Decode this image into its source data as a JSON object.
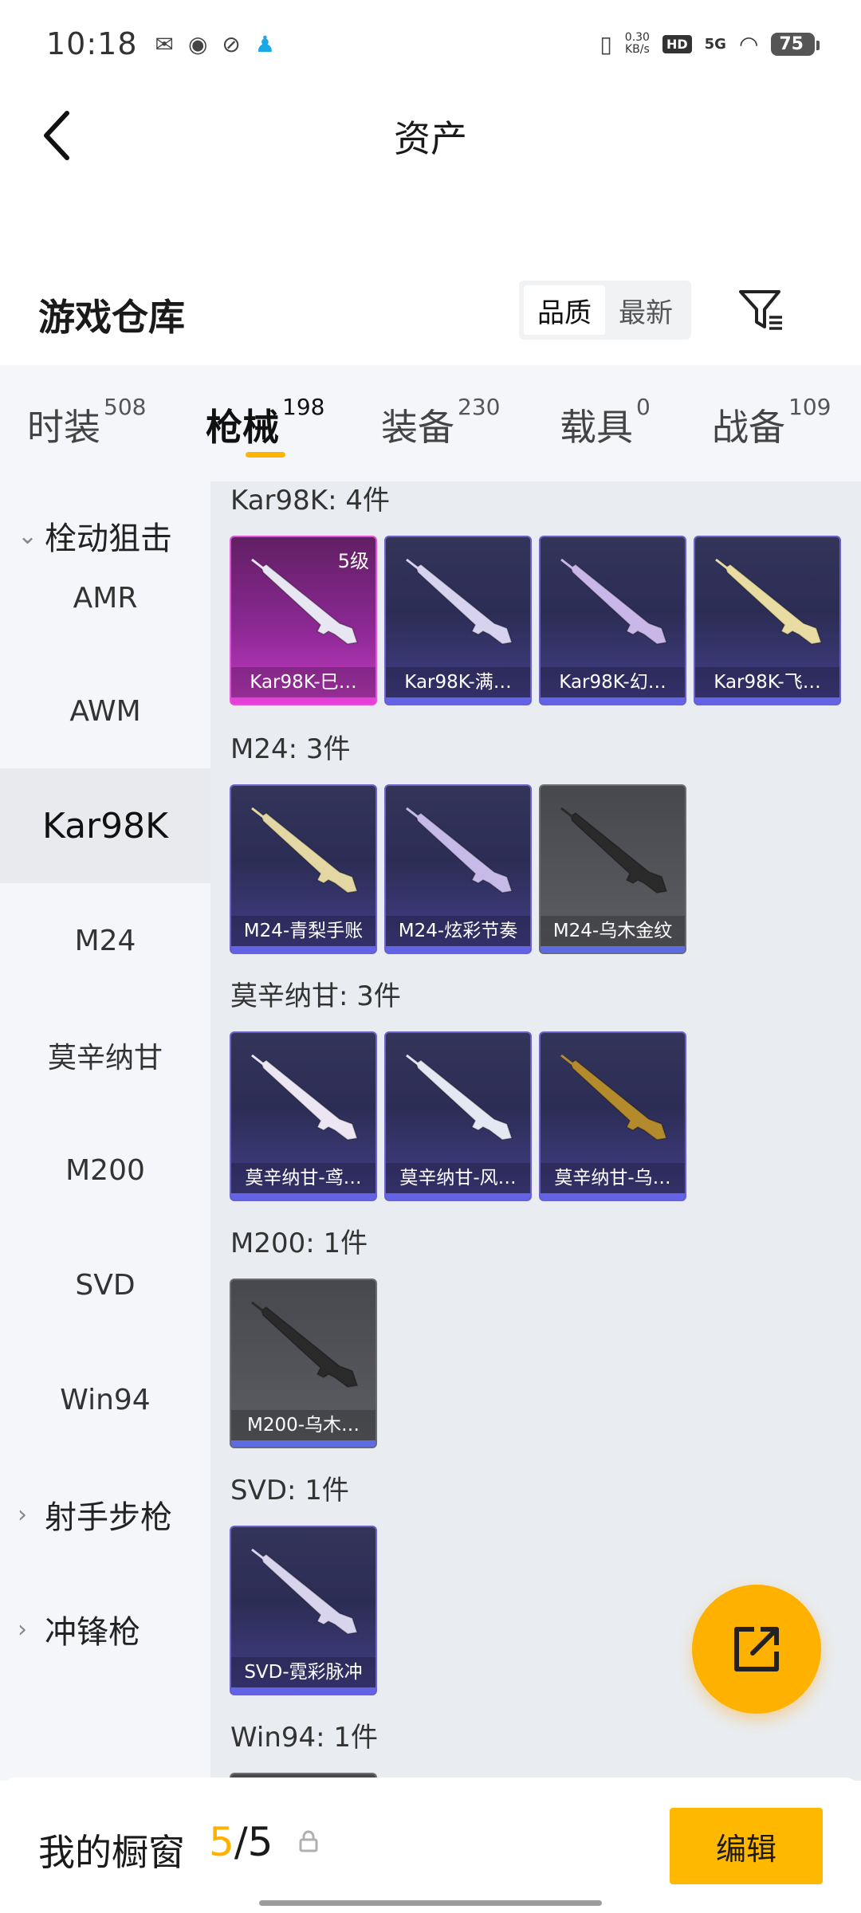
{
  "status_bar": {
    "time": "10:18",
    "net_speed_value": "0.30",
    "net_speed_unit": "KB/s",
    "hd": "HD",
    "signal": "5G",
    "battery": "75"
  },
  "header": {
    "title": "资产"
  },
  "warehouse": {
    "title": "游戏仓库",
    "sort_options": [
      "品质",
      "最新"
    ],
    "active_sort": "品质"
  },
  "tabs": [
    {
      "label": "时装",
      "count": "508"
    },
    {
      "label": "枪械",
      "count": "198"
    },
    {
      "label": "装备",
      "count": "230"
    },
    {
      "label": "载具",
      "count": "0"
    },
    {
      "label": "战备",
      "count": "109"
    }
  ],
  "active_tab": "枪械",
  "sidebar": {
    "items": [
      {
        "label": "栓动狙击",
        "type": "group",
        "chevron": "down"
      },
      {
        "label": "AMR",
        "type": "item"
      },
      {
        "label": "AWM",
        "type": "item"
      },
      {
        "label": "Kar98K",
        "type": "item",
        "active": true
      },
      {
        "label": "M24",
        "type": "item"
      },
      {
        "label": "莫辛纳甘",
        "type": "item"
      },
      {
        "label": "M200",
        "type": "item"
      },
      {
        "label": "SVD",
        "type": "item"
      },
      {
        "label": "Win94",
        "type": "item"
      },
      {
        "label": "射手步枪",
        "type": "group",
        "chevron": "right"
      },
      {
        "label": "冲锋枪",
        "type": "group",
        "chevron": "right"
      }
    ]
  },
  "groups": [
    {
      "title": "Kar98K: 4件",
      "items": [
        {
          "name": "Kar98K-巳…",
          "rarity": "pink",
          "level": "5级",
          "gun_color": "#e9e6f3"
        },
        {
          "name": "Kar98K-满…",
          "rarity": "purple",
          "gun_color": "#d7d3ef"
        },
        {
          "name": "Kar98K-幻…",
          "rarity": "purple",
          "gun_color": "#c9b7e9"
        },
        {
          "name": "Kar98K-飞…",
          "rarity": "purple",
          "gun_color": "#e8dca3"
        }
      ]
    },
    {
      "title": "M24: 3件",
      "items": [
        {
          "name": "M24-青梨手账",
          "rarity": "purple",
          "gun_color": "#e3d7a4"
        },
        {
          "name": "M24-炫彩节奏",
          "rarity": "purple",
          "gun_color": "#c6bbe8"
        },
        {
          "name": "M24-乌木金纹",
          "rarity": "gray",
          "gun_color": "#2a2a2a"
        }
      ]
    },
    {
      "title": "莫辛纳甘: 3件",
      "items": [
        {
          "name": "莫辛纳甘-鸢…",
          "rarity": "purple",
          "gun_color": "#ece6f2"
        },
        {
          "name": "莫辛纳甘-风…",
          "rarity": "purple",
          "gun_color": "#e3e9f2"
        },
        {
          "name": "莫辛纳甘-乌…",
          "rarity": "purple",
          "gun_color": "#b38a2c"
        }
      ]
    },
    {
      "title": "M200: 1件",
      "items": [
        {
          "name": "M200-乌木…",
          "rarity": "gray",
          "gun_color": "#2a2a2a"
        }
      ]
    },
    {
      "title": "SVD: 1件",
      "items": [
        {
          "name": "SVD-霓彩脉冲",
          "rarity": "purple",
          "gun_color": "#d9d4ee"
        }
      ]
    },
    {
      "title": "Win94: 1件",
      "items": []
    }
  ],
  "bottom_bar": {
    "label": "我的橱窗",
    "current": "5",
    "separator": "/",
    "total": "5",
    "edit_label": "编辑"
  },
  "colors": {
    "accent": "#ffb400",
    "rarity_purple": "#6363e6",
    "rarity_pink": "#e43fd6",
    "rarity_gray": "#5d6ce0"
  }
}
